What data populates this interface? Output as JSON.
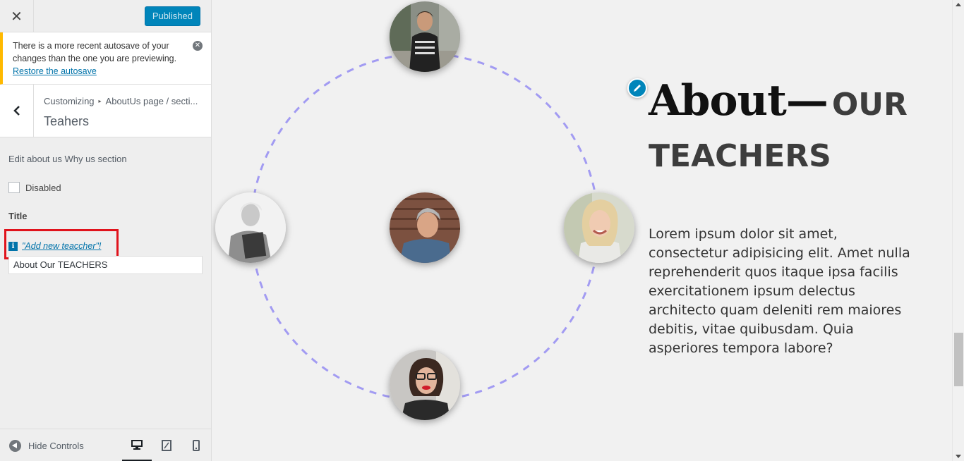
{
  "customizer": {
    "close_label": "✕",
    "publish_label": "Published",
    "autosave": {
      "message": "There is a more recent autosave of your changes than the one you are previewing.",
      "restore_link": "Restore the autosave"
    },
    "breadcrumb": {
      "root": "Customizing",
      "separator": "▸",
      "current": "AboutUs page / secti..."
    },
    "section_title": "Teahers",
    "section_description": "Edit about us Why us section",
    "disabled_label": "Disabled",
    "title_label": "Title",
    "add_teacher_link": "\"Add new teaccher\"!",
    "title_value": "About Our TEACHERS",
    "hide_controls_label": "Hide Controls"
  },
  "preview": {
    "heading_about": "About—",
    "heading_our": "OUR",
    "heading_teachers": "TEACHERS",
    "body": "Lorem ipsum dolor sit amet, consectetur adipisicing elit. Amet nulla reprehenderit quos itaque ipsa facilis exercitationem ipsum delectus architecto quam deleniti rem maiores debitis, vitae quibusdam. Quia asperiores tempora labore?",
    "orbit_color": "#a29bf2"
  },
  "colors": {
    "accent": "#0085ba",
    "notice_border": "#ffb900",
    "highlight_box": "#e0131c"
  },
  "icons": [
    "close-icon",
    "dismiss-icon",
    "back-icon",
    "info-icon",
    "hide-controls-icon",
    "desktop-icon",
    "tablet-icon",
    "mobile-icon",
    "edit-pencil-icon"
  ]
}
